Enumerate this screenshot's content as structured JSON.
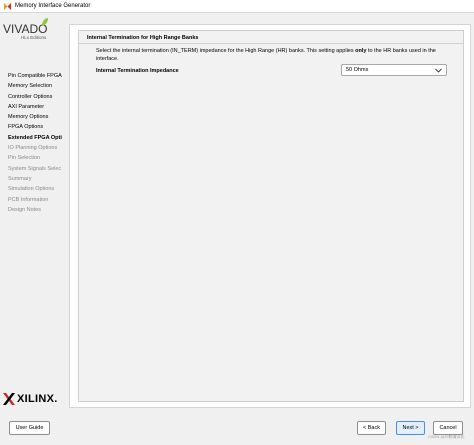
{
  "window": {
    "title": "Memory Interface Generator"
  },
  "logo": {
    "brand": "VIVADO",
    "edition": "HLx Editions"
  },
  "nav": {
    "items": [
      {
        "label": "Pin Compatible FPGA",
        "state": "normal"
      },
      {
        "label": "Memory Selection",
        "state": "normal"
      },
      {
        "label": "Controller Options",
        "state": "normal"
      },
      {
        "label": "AXI Parameter",
        "state": "normal"
      },
      {
        "label": "Memory Options",
        "state": "normal"
      },
      {
        "label": "FPGA Options",
        "state": "normal"
      },
      {
        "label": "Extended FPGA Opti",
        "state": "active"
      },
      {
        "label": "IO Planning Options",
        "state": "disabled"
      },
      {
        "label": "Pin Selection",
        "state": "disabled"
      },
      {
        "label": "System Signals Selec",
        "state": "disabled"
      },
      {
        "label": "Summary",
        "state": "disabled"
      },
      {
        "label": "Simulation Options",
        "state": "disabled"
      },
      {
        "label": "PCB Information",
        "state": "disabled"
      },
      {
        "label": "Design Notes",
        "state": "disabled"
      }
    ]
  },
  "vendor": {
    "name": "XILINX."
  },
  "section": {
    "title": "Internal Termination for High Range Banks",
    "desc_before": "Select the internal termination (IN_TERM) impedance for the High Range (HR) banks. This setting applies ",
    "desc_strong": "only",
    "desc_after": " to the HR banks used in the interface.",
    "field_label": "Internal Termination Impedance",
    "select_value": "50 Ohms"
  },
  "footer": {
    "user_guide": "User Guide",
    "back": "< Back",
    "next": "Next >",
    "cancel": "Cancel",
    "watermark": "CSDN @川鹤海洋氏"
  },
  "colors": {
    "accent": "#4a8fe7",
    "xilinx_red": "#d2232a",
    "vivado_leaf": "#8dc63f"
  }
}
